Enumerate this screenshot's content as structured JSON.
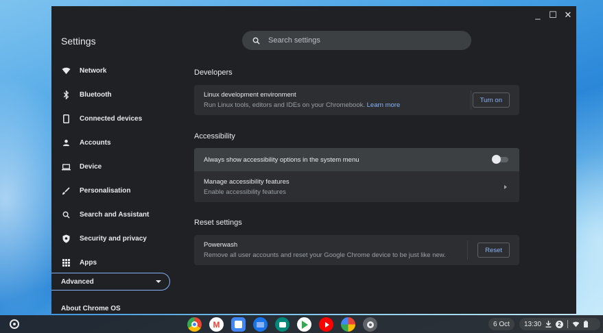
{
  "window": {
    "title": "Settings",
    "controls": {
      "minimize": "_",
      "maximize": "☐",
      "close": "✕"
    }
  },
  "search": {
    "placeholder": "Search settings"
  },
  "sidebar": {
    "items": [
      {
        "label": "Network",
        "icon": "wifi-icon"
      },
      {
        "label": "Bluetooth",
        "icon": "bluetooth-icon"
      },
      {
        "label": "Connected devices",
        "icon": "phone-icon"
      },
      {
        "label": "Accounts",
        "icon": "person-icon"
      },
      {
        "label": "Device",
        "icon": "laptop-icon"
      },
      {
        "label": "Personalisation",
        "icon": "brush-icon"
      },
      {
        "label": "Search and Assistant",
        "icon": "search-icon"
      },
      {
        "label": "Security and privacy",
        "icon": "shield-icon"
      },
      {
        "label": "Apps",
        "icon": "apps-grid-icon"
      }
    ],
    "advanced": "Advanced",
    "about": "About Chrome OS"
  },
  "developers": {
    "title": "Developers",
    "linux_title": "Linux development environment",
    "linux_sub": "Run Linux tools, editors and IDEs on your Chromebook.",
    "linux_link": "Learn more",
    "turn_on": "Turn on"
  },
  "accessibility": {
    "title": "Accessibility",
    "always_show": "Always show accessibility options in the system menu",
    "always_show_enabled": false,
    "manage_title": "Manage accessibility features",
    "manage_sub": "Enable accessibility features"
  },
  "reset": {
    "title": "Reset settings",
    "powerwash_title": "Powerwash",
    "powerwash_sub": "Remove all user accounts and reset your Google Chrome device to be just like new.",
    "reset_button": "Reset"
  },
  "shelf": {
    "date": "6 Oct",
    "time": "13:30",
    "notification_count": "2",
    "apps": [
      "chrome",
      "gmail",
      "calendar",
      "files",
      "meet",
      "play-store",
      "youtube",
      "photos",
      "settings"
    ]
  },
  "colors": {
    "accent": "#8ab4f8",
    "background": "#202124",
    "card": "#2d2e31"
  }
}
